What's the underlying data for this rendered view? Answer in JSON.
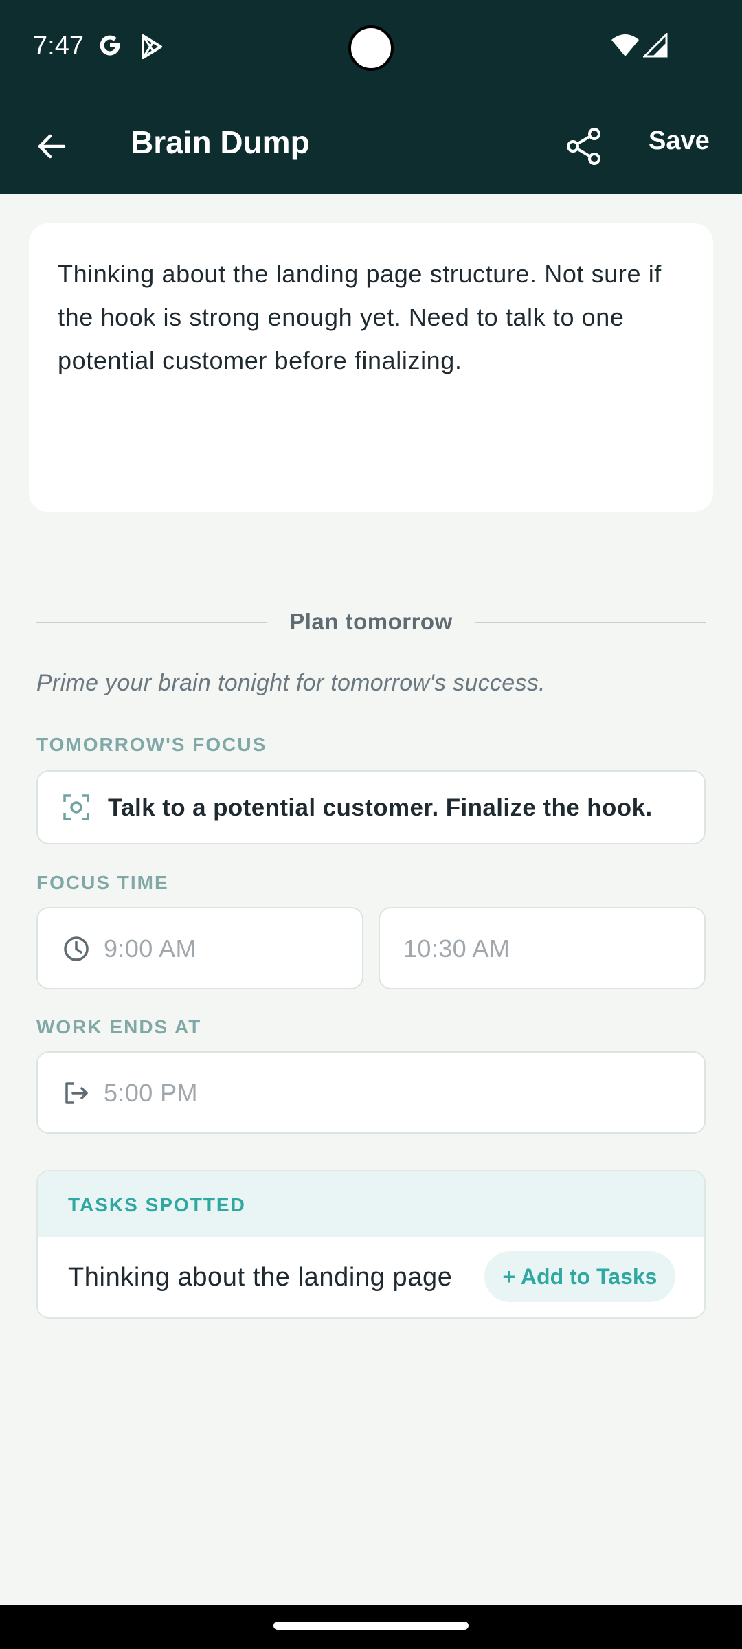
{
  "status_bar": {
    "time": "7:47",
    "icons": [
      "google-icon",
      "play-store-icon",
      "wifi-icon",
      "signal-icon"
    ]
  },
  "app_bar": {
    "title": "Brain Dump",
    "save_label": "Save",
    "background": "#0D2D2F"
  },
  "note": {
    "text": "Thinking about the landing page structure. Not sure if the hook is strong enough yet. Need to talk to one potential customer before finalizing."
  },
  "plan": {
    "heading": "Plan tomorrow",
    "subtitle": "Prime your brain tonight for tomorrow's success.",
    "focus_label": "TOMORROW'S FOCUS",
    "focus_value": "Talk to a potential customer. Finalize the hook.",
    "focus_time_label": "FOCUS TIME",
    "focus_start_placeholder": "9:00 AM",
    "focus_end_placeholder": "10:30 AM",
    "work_ends_label": "WORK ENDS AT",
    "work_ends_placeholder": "5:00 PM"
  },
  "tasks": {
    "header": "TASKS SPOTTED",
    "items": [
      {
        "text": "Thinking about the landing page",
        "action_label": "+ Add to Tasks"
      }
    ],
    "accent": "#2EA8A0"
  }
}
